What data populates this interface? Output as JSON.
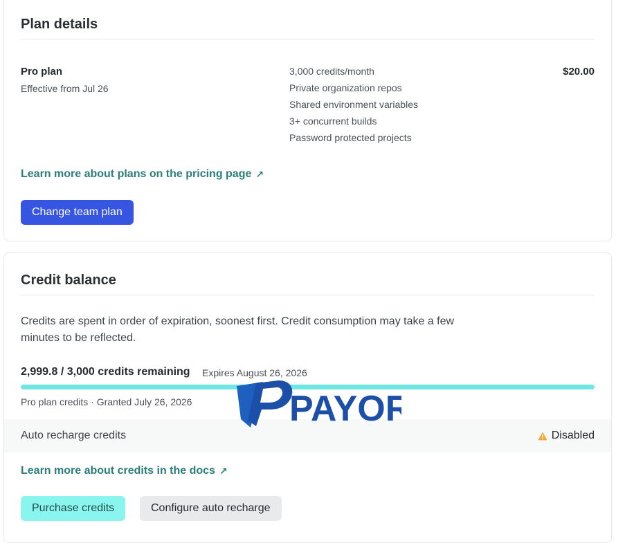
{
  "plan": {
    "title": "Plan details",
    "name": "Pro plan",
    "effective": "Effective from Jul 26",
    "features": [
      "3,000 credits/month",
      "Private organization repos",
      "Shared environment variables",
      "3+ concurrent builds",
      "Password protected projects"
    ],
    "price": "$20.00",
    "pricing_link": "Learn more about plans on the pricing page",
    "change_button": "Change team plan"
  },
  "credit": {
    "title": "Credit balance",
    "description": "Credits are spent in order of expiration, soonest first. Credit consumption may take a few minutes to be reflected.",
    "remaining": "2,999.8 / 3,000 credits remaining",
    "remaining_fraction": 0.99993,
    "expires": "Expires August 26, 2026",
    "granted": "Pro plan credits · Granted July 26, 2026",
    "auto_recharge_label": "Auto recharge credits",
    "auto_recharge_status": "Disabled",
    "docs_link": "Learn more about credits in the docs",
    "purchase_button": "Purchase credits",
    "configure_button": "Configure auto recharge"
  },
  "watermark": {
    "text": "PAYOR"
  },
  "colors": {
    "primary": "#3655e0",
    "link": "#2a7e7a",
    "teal": "#8af5ef",
    "progress": "#6ee7e2",
    "warning": "#f0a830"
  }
}
